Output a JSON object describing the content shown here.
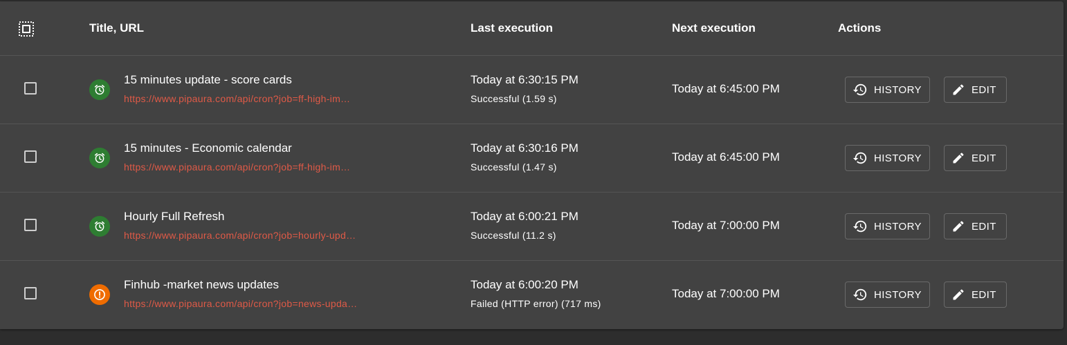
{
  "header": {
    "title_url": "Title, URL",
    "last_execution": "Last execution",
    "next_execution": "Next execution",
    "actions": "Actions"
  },
  "actions": {
    "history_label": "HISTORY",
    "edit_label": "EDIT"
  },
  "colors": {
    "success": "#2e7d32",
    "warning": "#ef6c00",
    "url": "#e05a47"
  },
  "jobs": [
    {
      "title": "15 minutes update - score cards",
      "url": "https://www.pipaura.com/api/cron?job=ff-high-im…",
      "status_icon": "alarm-icon",
      "last_time": "Today at 6:30:15 PM",
      "last_status": "Successful (1.59 s)",
      "next_time": "Today at 6:45:00 PM"
    },
    {
      "title": "15 minutes - Economic calendar",
      "url": "https://www.pipaura.com/api/cron?job=ff-high-im…",
      "status_icon": "alarm-icon",
      "last_time": "Today at 6:30:16 PM",
      "last_status": "Successful (1.47 s)",
      "next_time": "Today at 6:45:00 PM"
    },
    {
      "title": "Hourly Full Refresh",
      "url": "https://www.pipaura.com/api/cron?job=hourly-upd…",
      "status_icon": "alarm-icon",
      "last_time": "Today at 6:00:21 PM",
      "last_status": "Successful (11.2 s)",
      "next_time": "Today at 7:00:00 PM"
    },
    {
      "title": "Finhub -market news updates",
      "url": "https://www.pipaura.com/api/cron?job=news-upda…",
      "status_icon": "error-icon",
      "last_time": "Today at 6:00:20 PM",
      "last_status": "Failed (HTTP error) (717 ms)",
      "next_time": "Today at 7:00:00 PM"
    }
  ]
}
